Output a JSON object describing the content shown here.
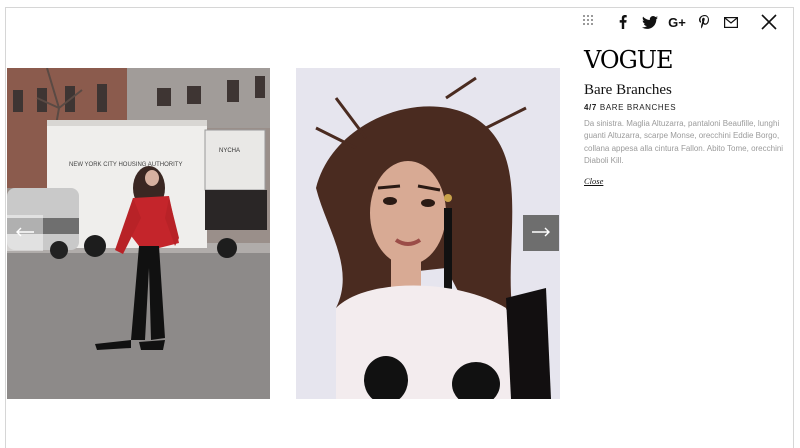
{
  "toolbar": {
    "icons": [
      "grid-icon",
      "facebook-icon",
      "twitter-icon",
      "google-plus-icon",
      "pinterest-icon",
      "mail-icon",
      "close-icon"
    ],
    "google_plus_label": "G+"
  },
  "gallery": {
    "prev_icon": "arrow-left-icon",
    "next_icon": "arrow-right-icon",
    "truck_text": "NEW YORK CITY HOUSING AUTHORITY",
    "truck_plate": "NYCHA"
  },
  "panel": {
    "logo": "VOGUE",
    "title": "Bare Branches",
    "counter": "4/7",
    "counter_label": "BARE BRANCHES",
    "caption": "Da sinistra. Maglia Altuzarra, pantaloni Beaufille, lunghi guanti Altuzarra, scarpe Monse, orecchini Eddie Borgo, collana appesa alla cintura Fallon. Abito Tome, orecchini Diaboli Kill.",
    "close_label": "Close"
  },
  "colors": {
    "accent": "#111111",
    "caption": "#9b9b9b",
    "next_arrow_bg": "#6e6e6e",
    "sweater_red": "#c4252b"
  }
}
